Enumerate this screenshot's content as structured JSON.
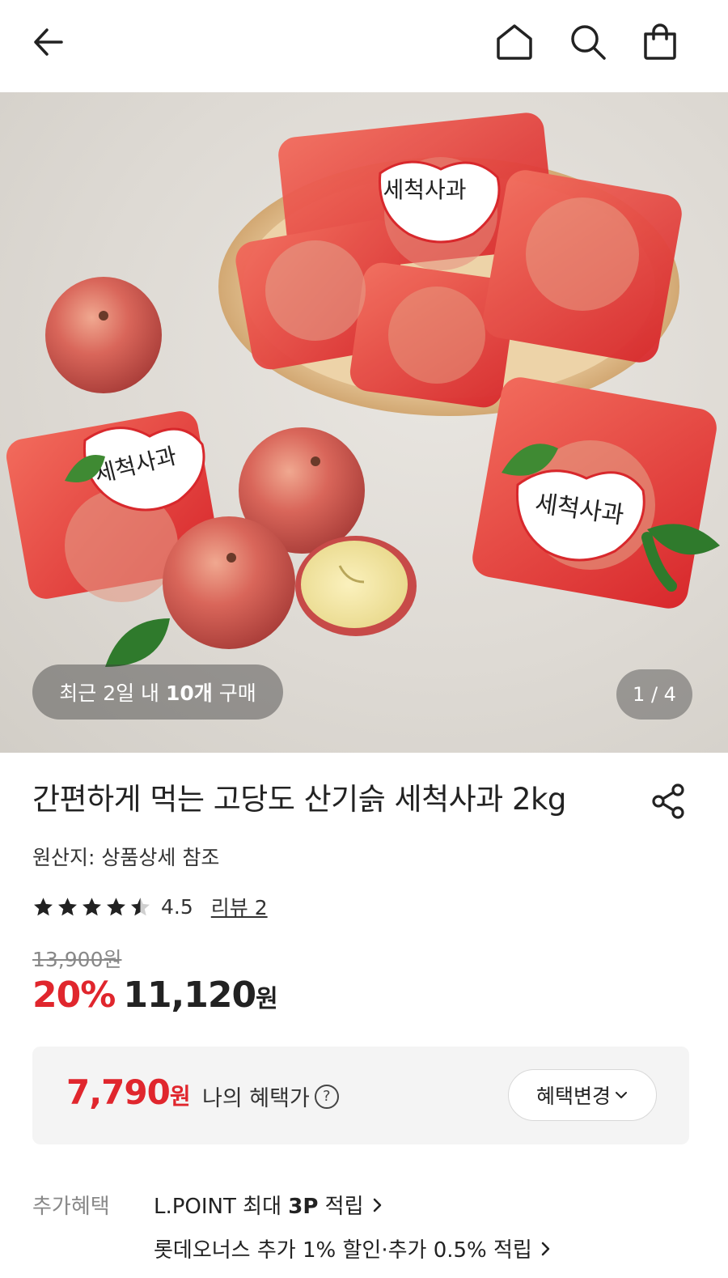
{
  "header": {
    "back_icon": "arrow-left-icon",
    "home_icon": "home-icon",
    "search_icon": "search-icon",
    "cart_icon": "shopping-bag-icon"
  },
  "gallery": {
    "recent_prefix": "최근 2일 내 ",
    "recent_count": "10개",
    "recent_suffix": " 구매",
    "page_indicator": "1 / 4",
    "label_text": "세척사과"
  },
  "product": {
    "title": "간편하게 먹는 고당도 산기슭 세척사과 2kg",
    "origin": "원산지: 상품상세 참조",
    "rating": 4.5,
    "rating_text": "4.5",
    "review_link": "리뷰 2",
    "original_price": "13,900원",
    "discount": "20%",
    "sale_price": "11,120",
    "sale_unit": "원"
  },
  "benefit": {
    "my_price": "7,790",
    "my_price_unit": "원",
    "my_price_label": "나의 혜택가",
    "help_icon": "?",
    "change_button": "혜택변경"
  },
  "extra": {
    "label": "추가혜택",
    "items": [
      {
        "prefix": "L.POINT 최대 ",
        "bold": "3P",
        "suffix": " 적립"
      },
      {
        "prefix": "롯데오너스 추가 1% 할인·추가 0.5% 적립",
        "bold": "",
        "suffix": ""
      }
    ]
  },
  "colors": {
    "accent_red": "#e0262d",
    "star": "#222222"
  }
}
